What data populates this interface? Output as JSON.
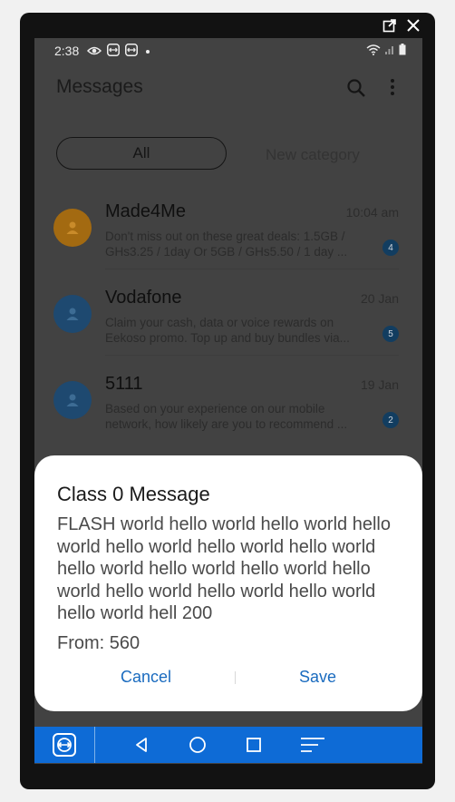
{
  "status_bar": {
    "time": "2:38"
  },
  "app": {
    "title": "Messages"
  },
  "tabs": [
    {
      "label": "All"
    },
    {
      "label": "New category"
    }
  ],
  "conversations": [
    {
      "name": "Made4Me",
      "time": "10:04 am",
      "preview": "Don't miss out on these great deals: 1.5GB / GHs3.25 / 1day Or 5GB / GHs5.50 / 1 day ...",
      "unread": "4",
      "avatar_color": "#a36a11"
    },
    {
      "name": "Vodafone",
      "time": "20 Jan",
      "preview": "Claim your cash, data or voice rewards on Eekoso promo. Top up and buy bundles via...",
      "unread": "5",
      "avatar_color": "#1e4970"
    },
    {
      "name": "5111",
      "time": "19 Jan",
      "preview": "Based on your experience on our mobile network, how likely are you to recommend ...",
      "unread": "2",
      "avatar_color": "#1e4970"
    }
  ],
  "dialog": {
    "title": "Class 0 Message",
    "body": "FLASH world hello world hello world hello world hello world hello world hello world hello world hello world hello world hello world hello world hello world hello world hello world hell 200",
    "from": "From: 560",
    "cancel_label": "Cancel",
    "save_label": "Save"
  },
  "colors": {
    "nav_bar": "#0e6bd6",
    "accent": "#1a6bbf",
    "dim_background": "#424242"
  },
  "icons": {
    "frame": [
      "external-link-icon",
      "close-icon"
    ],
    "status": [
      "eye-icon",
      "teamviewer-icon",
      "teamviewer-icon",
      "dot-icon",
      "wifi-icon",
      "signal-icon",
      "battery-icon"
    ],
    "app_bar": [
      "search-icon",
      "more-vert-icon"
    ],
    "nav": [
      "teamviewer-icon",
      "back-icon",
      "home-icon",
      "recents-icon",
      "menu-icon"
    ]
  }
}
